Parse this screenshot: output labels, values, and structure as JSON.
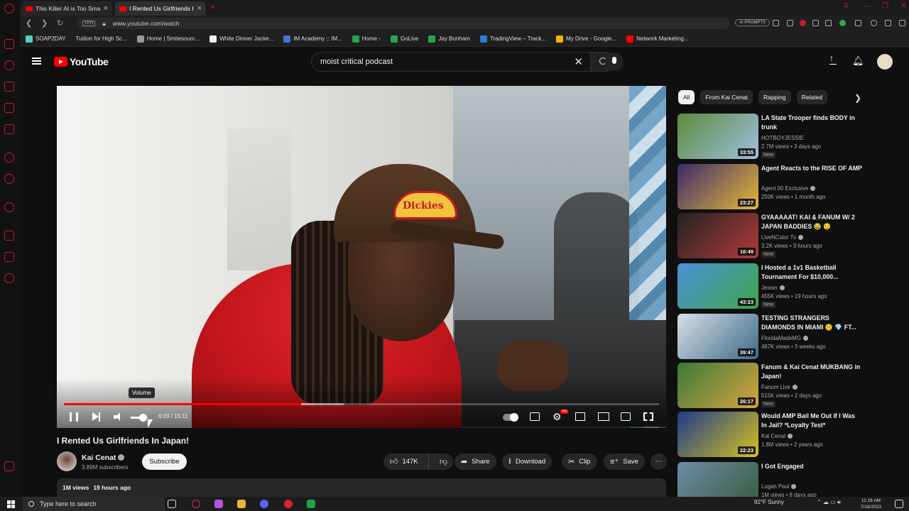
{
  "browser": {
    "tabs": [
      {
        "title": "This Killer AI is Too Smart"
      },
      {
        "title": "I Rented Us Girlfriends I"
      }
    ],
    "new_tab_glyph": "+",
    "close_glyph": "×",
    "vpn_label": "VPN",
    "url": "www.youtube.com/watch",
    "ai_prompts_label": "AI PROMPTS",
    "bookmarks": [
      {
        "label": "SOAP2DAY"
      },
      {
        "label": "Tuition for High Sc..."
      },
      {
        "label": "Home | Smitesourc..."
      },
      {
        "label": "White Dinner Jacke..."
      },
      {
        "label": "IM Academy :: IM..."
      },
      {
        "label": "Home -"
      },
      {
        "label": "GoLive"
      },
      {
        "label": "Jay Bonham"
      },
      {
        "label": "TradingView – Track..."
      },
      {
        "label": "My Drive - Google..."
      },
      {
        "label": "Network Marketing..."
      }
    ]
  },
  "youtube": {
    "logo_text": "YouTube",
    "search": {
      "value": "moist critical podcast",
      "clear_glyph": "✕"
    }
  },
  "player": {
    "progress_played": 0.398,
    "progress_buffered": 0.47,
    "volume": 0.7,
    "time_current": "6:09",
    "time_separator": " / ",
    "time_total": "15:11",
    "tooltip": "Volume",
    "hd_badge": "HD",
    "patch_text": "Dickies"
  },
  "video": {
    "title": "I Rented Us Girlfriends In Japan!",
    "channel": "Kai Cenat",
    "subscribers": "3.89M subscribers",
    "subscribe_label": "Subscribe",
    "likes": "147K",
    "share_label": "Share",
    "download_label": "Download",
    "clip_label": "Clip",
    "save_label": "Save",
    "views": "1M views",
    "posted": "19 hours ago"
  },
  "chips": [
    "All",
    "From Kai Cenat",
    "Rapping",
    "Related"
  ],
  "recommendations": [
    {
      "title": "LA State Trooper finds BODY in trunk",
      "channel": "HOTBOYJESSIE",
      "verified": false,
      "meta": "2.7M views • 3 days ago",
      "badge": "New",
      "duration": "33:55",
      "thumb_colors": [
        "#5d8a3c",
        "#9fc0e0"
      ]
    },
    {
      "title": "Agent Reacts to the RISE OF AMP",
      "channel": "Agent 00 Exclusive",
      "verified": true,
      "meta": "250K views • 1 month ago",
      "badge": "",
      "duration": "23:27",
      "thumb_colors": [
        "#3a2a6a",
        "#e8b83a"
      ]
    },
    {
      "title": "GYAAAAAT! KAI & FANUM W/ 2 JAPAN BADDIES 😂 😏",
      "channel": "LiveNColor Tv",
      "verified": true,
      "meta": "3.2K views • 3 hours ago",
      "badge": "New",
      "duration": "16:49",
      "thumb_colors": [
        "#222222",
        "#b33a3a"
      ]
    },
    {
      "title": "I Hosted a 1v1 Basketball Tournament For $10,000...",
      "channel": "Jesser",
      "verified": true,
      "meta": "455K views • 19 hours ago",
      "badge": "New",
      "duration": "43:23",
      "thumb_colors": [
        "#4a90d9",
        "#3fa64a"
      ]
    },
    {
      "title": "TESTING STRANGERS DIAMONDS IN MIAMI 🤫 💎 FT...",
      "channel": "FloridaMadeMG",
      "verified": true,
      "meta": "487K views • 3 weeks ago",
      "badge": "",
      "duration": "39:47",
      "thumb_colors": [
        "#d8dfe6",
        "#3d6a8a"
      ]
    },
    {
      "title": "Fanum & Kai Cenat MUKBANG in Japan!",
      "channel": "Fanum Live",
      "verified": true,
      "meta": "515K views • 2 days ago",
      "badge": "New",
      "duration": "26:17",
      "thumb_colors": [
        "#3a7a3a",
        "#d9a441"
      ]
    },
    {
      "title": "Would AMP Bail Me Out If I Was In Jail? *Loyalty Test*",
      "channel": "Kai Cenat",
      "verified": true,
      "meta": "1.8M views • 2 years ago",
      "badge": "",
      "duration": "22:23",
      "thumb_colors": [
        "#1f3a8a",
        "#d4c21f"
      ]
    },
    {
      "title": "I Got Engaged",
      "channel": "Logan Paul",
      "verified": true,
      "meta": "1M views • 8 days ago",
      "badge": "",
      "duration": "",
      "thumb_colors": [
        "#6d8ca8",
        "#3a5a3a"
      ]
    }
  ],
  "taskbar": {
    "search_placeholder": "Type here to search",
    "weather": "92°F  Sunny",
    "time": "11:16 AM",
    "date": "7/18/2023"
  }
}
